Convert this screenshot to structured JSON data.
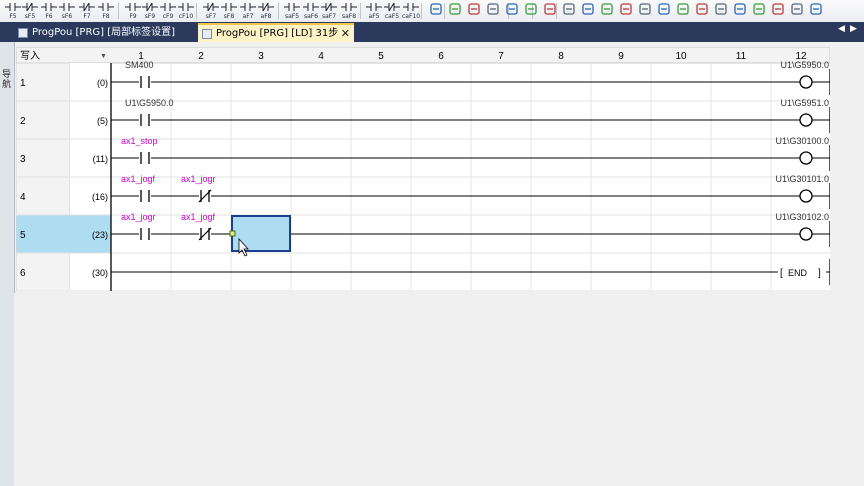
{
  "toolbar": {
    "keys": [
      "F5",
      "sF5",
      "F6",
      "sF6",
      "F7",
      "F8",
      "F9",
      "sF9",
      "cF9",
      "cF10",
      "sF7",
      "sF8",
      "aF7",
      "aF8",
      "saF5",
      "saF6",
      "saF7",
      "saF8",
      "aF5",
      "caF5",
      "caF10"
    ]
  },
  "tabs": [
    {
      "label": "ProgPou [PRG] [局部标签设置]",
      "active": false
    },
    {
      "label": "ProgPou [PRG] [LD] 31步",
      "active": true
    }
  ],
  "sidebar": {
    "label": "导航"
  },
  "ladder": {
    "mode": "写入",
    "columns": [
      "1",
      "2",
      "3",
      "4",
      "5",
      "6",
      "7",
      "8",
      "9",
      "10",
      "11",
      "12"
    ],
    "rungs": [
      {
        "row": "1",
        "step": "(0)",
        "c1": "SM400",
        "c2": "",
        "coil": "U1\\G5950.0"
      },
      {
        "row": "2",
        "step": "(5)",
        "c1": "U1\\G5950.0",
        "c2": "",
        "coil": "U1\\G5951.0"
      },
      {
        "row": "3",
        "step": "(11)",
        "c1": "ax1_stop",
        "c2": "",
        "coil": "U1\\G30100.0"
      },
      {
        "row": "4",
        "step": "(16)",
        "c1": "ax1_jogf",
        "c2": "ax1_jogr",
        "coil": "U1\\G30101.0"
      },
      {
        "row": "5",
        "step": "(23)",
        "c1": "ax1_jogr",
        "c2": "ax1_jogf",
        "coil": "U1\\G30102.0"
      },
      {
        "row": "6",
        "step": "(30)",
        "c1": "",
        "c2": "",
        "coil": "END"
      }
    ]
  },
  "colors": {
    "device_label": "#cc00cc",
    "selection": "#aedcf0",
    "tab_active": "#fdf3c6",
    "header": "#f0f0f0"
  }
}
